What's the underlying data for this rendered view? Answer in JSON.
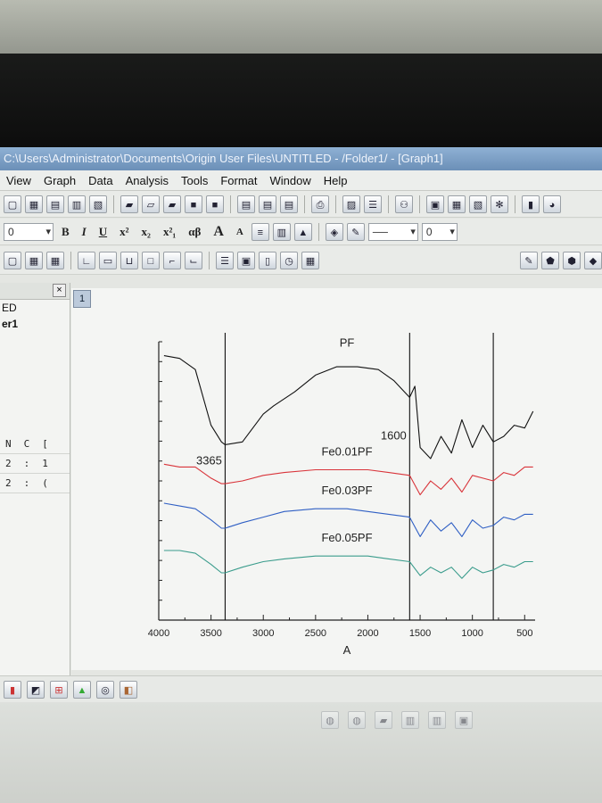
{
  "window": {
    "title": "C:\\Users\\Administrator\\Documents\\Origin User Files\\UNTITLED - /Folder1/ - [Graph1]"
  },
  "menu": {
    "items": [
      "View",
      "Graph",
      "Data",
      "Analysis",
      "Tools",
      "Format",
      "Window",
      "Help"
    ]
  },
  "format_toolbar": {
    "font_size_value": "0",
    "bold_label": "B",
    "italic_label": "I",
    "underline_label": "U",
    "superscript_label": "x²",
    "subscript_label": "x₂",
    "supsub_label": "x²₁",
    "greek_label": "αβ",
    "increase_font_label": "A",
    "decrease_font_label": "A",
    "line_width_value": "0"
  },
  "left_panel": {
    "folder_label": "ED",
    "item_label": "er1",
    "grid_header": [
      "N",
      "C",
      "["
    ],
    "grid_rows": [
      [
        "2",
        ":",
        "1"
      ],
      [
        "2",
        ":",
        "("
      ]
    ]
  },
  "graph": {
    "layer_tab_label": "1"
  },
  "chart_data": {
    "type": "line",
    "xlabel": "A",
    "xlim": [
      4000,
      400
    ],
    "x_reversed": true,
    "x_ticks": [
      4000,
      3500,
      3000,
      2500,
      2000,
      1500,
      1000,
      500
    ],
    "grid": false,
    "legend": "none",
    "series": [
      {
        "name": "PF",
        "color": "#111111",
        "x": [
          3950,
          3800,
          3650,
          3500,
          3400,
          3365,
          3200,
          3000,
          2900,
          2700,
          2500,
          2300,
          2100,
          1900,
          1750,
          1650,
          1600,
          1550,
          1500,
          1400,
          1300,
          1200,
          1100,
          1000,
          900,
          800,
          700,
          600,
          500,
          420
        ],
        "y": [
          0.95,
          0.94,
          0.9,
          0.7,
          0.64,
          0.63,
          0.64,
          0.74,
          0.77,
          0.82,
          0.88,
          0.91,
          0.91,
          0.9,
          0.86,
          0.82,
          0.8,
          0.84,
          0.62,
          0.58,
          0.66,
          0.6,
          0.72,
          0.62,
          0.7,
          0.64,
          0.66,
          0.7,
          0.69,
          0.75
        ]
      },
      {
        "name": "Fe0.01PF",
        "color": "#d9343a",
        "x": [
          3950,
          3800,
          3650,
          3500,
          3400,
          3365,
          3200,
          3000,
          2800,
          2500,
          2200,
          2000,
          1800,
          1600,
          1500,
          1400,
          1300,
          1200,
          1100,
          1000,
          900,
          800,
          700,
          600,
          500,
          420
        ],
        "y": [
          0.56,
          0.55,
          0.55,
          0.51,
          0.49,
          0.49,
          0.5,
          0.52,
          0.53,
          0.54,
          0.54,
          0.54,
          0.53,
          0.52,
          0.45,
          0.5,
          0.47,
          0.51,
          0.46,
          0.52,
          0.51,
          0.5,
          0.53,
          0.52,
          0.55,
          0.55
        ]
      },
      {
        "name": "Fe0.03PF",
        "color": "#2f5fc4",
        "x": [
          3950,
          3800,
          3650,
          3500,
          3400,
          3365,
          3200,
          3000,
          2800,
          2500,
          2200,
          2000,
          1800,
          1600,
          1500,
          1400,
          1300,
          1200,
          1100,
          1000,
          900,
          800,
          700,
          600,
          500,
          420
        ],
        "y": [
          0.42,
          0.41,
          0.4,
          0.36,
          0.33,
          0.33,
          0.35,
          0.37,
          0.39,
          0.4,
          0.4,
          0.39,
          0.38,
          0.37,
          0.3,
          0.36,
          0.32,
          0.35,
          0.3,
          0.36,
          0.33,
          0.34,
          0.37,
          0.36,
          0.38,
          0.38
        ]
      },
      {
        "name": "Fe0.05PF",
        "color": "#3a9c8c",
        "x": [
          3950,
          3800,
          3650,
          3500,
          3400,
          3365,
          3200,
          3000,
          2800,
          2500,
          2200,
          2000,
          1800,
          1600,
          1500,
          1400,
          1300,
          1200,
          1100,
          1000,
          900,
          800,
          700,
          600,
          500,
          420
        ],
        "y": [
          0.25,
          0.25,
          0.24,
          0.2,
          0.17,
          0.17,
          0.19,
          0.21,
          0.22,
          0.23,
          0.23,
          0.23,
          0.22,
          0.21,
          0.16,
          0.19,
          0.17,
          0.19,
          0.15,
          0.19,
          0.17,
          0.18,
          0.2,
          0.19,
          0.21,
          0.21
        ]
      }
    ],
    "annotations": [
      {
        "text": "3365",
        "x": 3365,
        "y": 0.63
      },
      {
        "text": "1600",
        "x": 1600,
        "y": 0.72
      }
    ],
    "vertical_lines": [
      3365,
      1600,
      800
    ]
  }
}
